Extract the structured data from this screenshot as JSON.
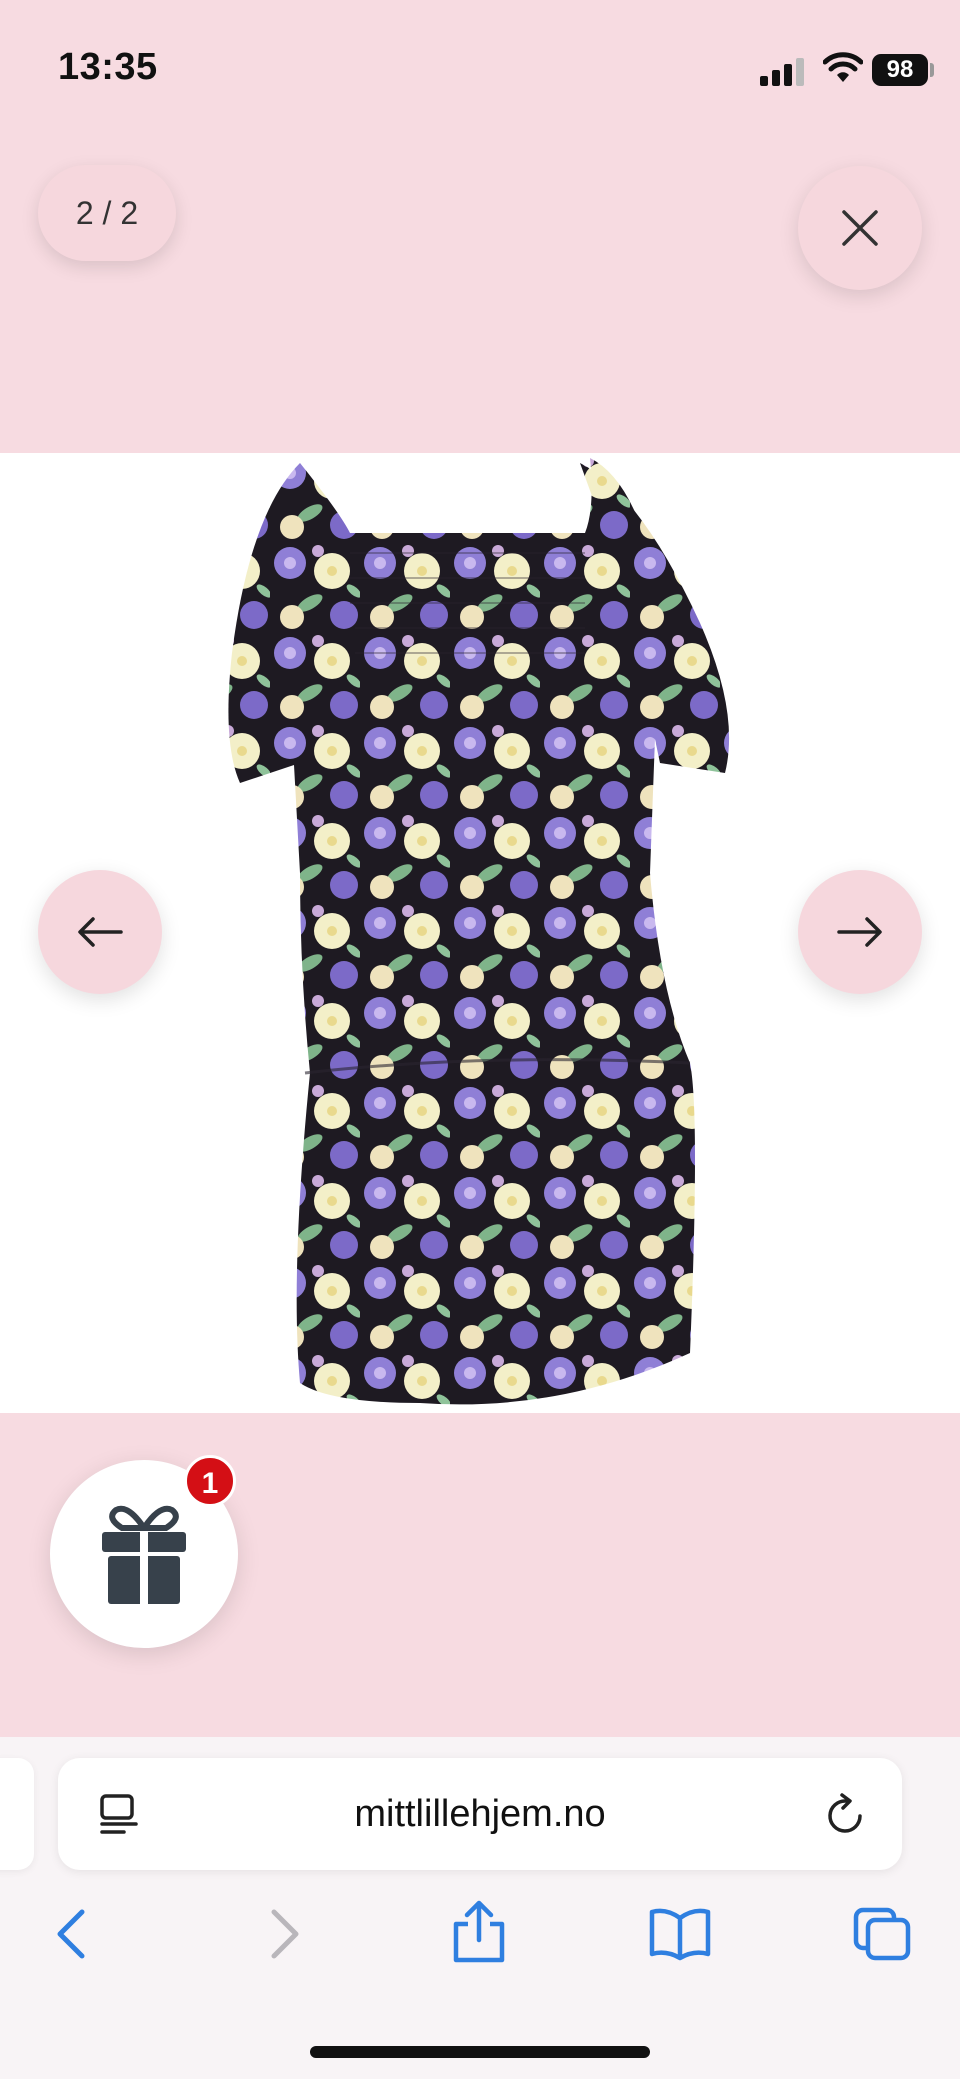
{
  "status_bar": {
    "time": "13:35",
    "battery": "98"
  },
  "gallery": {
    "counter": "2 / 2"
  },
  "gift": {
    "badge_count": "1"
  },
  "browser": {
    "url": "mittlillehjem.no"
  },
  "colors": {
    "background": "#f7dbe1",
    "badge": "#d40f15",
    "accent": "#2f7fe0"
  },
  "icons": {
    "close": "close-icon",
    "prev": "arrow-left-icon",
    "next": "arrow-right-icon",
    "gift": "gift-icon",
    "reader": "reader-icon",
    "reload": "reload-icon",
    "back": "back-icon",
    "forward": "forward-icon",
    "share": "share-icon",
    "bookmarks": "bookmarks-icon",
    "tabs": "tabs-icon"
  }
}
